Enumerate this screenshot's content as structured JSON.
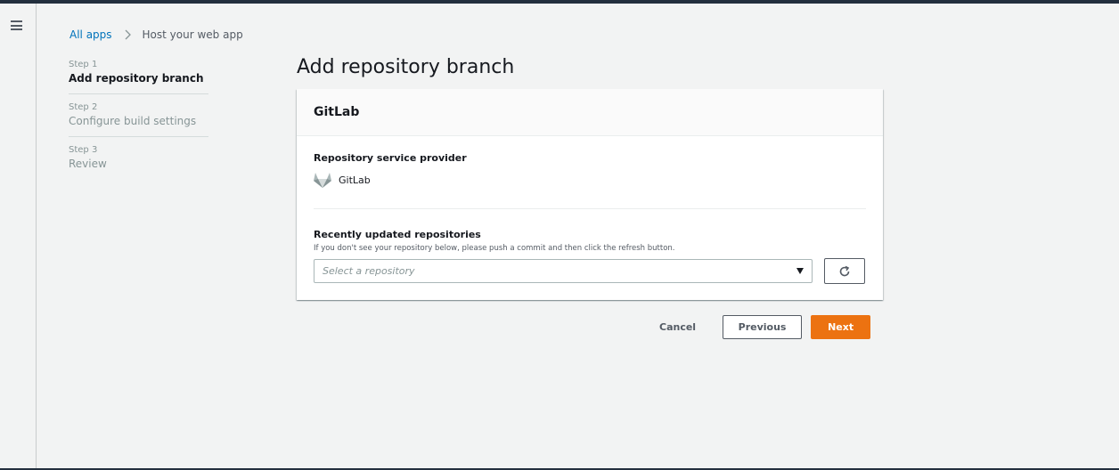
{
  "breadcrumb": {
    "root": "All apps",
    "current": "Host your web app"
  },
  "steps": [
    {
      "num": "Step 1",
      "name": "Add repository branch",
      "active": true
    },
    {
      "num": "Step 2",
      "name": "Configure build settings",
      "active": false
    },
    {
      "num": "Step 3",
      "name": "Review",
      "active": false
    }
  ],
  "page": {
    "title": "Add repository branch"
  },
  "card": {
    "header": "GitLab",
    "provider_label": "Repository service provider",
    "provider_name": "GitLab",
    "repos_label": "Recently updated repositories",
    "repos_hint": "If you don't see your repository below, please push a commit and then click the refresh button.",
    "select_placeholder": "Select a repository"
  },
  "actions": {
    "cancel": "Cancel",
    "previous": "Previous",
    "next": "Next"
  },
  "icons": {
    "menu": "hamburger-menu-icon",
    "separator": "chevron-right-icon",
    "provider": "gitlab-logo-icon",
    "refresh": "refresh-icon",
    "dropdown": "caret-down-icon"
  },
  "colors": {
    "accent": "#ec7211",
    "link": "#0073bb",
    "nav": "#232f3e"
  }
}
